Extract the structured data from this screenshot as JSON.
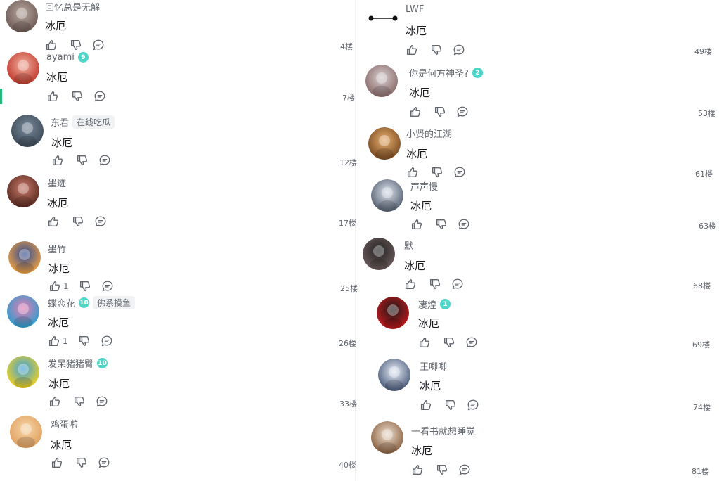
{
  "left": [
    {
      "user": "回忆总是无解",
      "level": "",
      "tag": "",
      "text": "冰厄",
      "likes": "",
      "floor": "4楼"
    },
    {
      "user": "ayami",
      "level": "9",
      "tag": "",
      "text": "冰厄",
      "likes": "",
      "floor": "7楼"
    },
    {
      "user": "东君",
      "level": "",
      "tag": "在线吃瓜",
      "text": "冰厄",
      "likes": "",
      "floor": "12楼"
    },
    {
      "user": "墨迹",
      "level": "",
      "tag": "",
      "text": "冰厄",
      "likes": "",
      "floor": "17楼"
    },
    {
      "user": "墨竹",
      "level": "",
      "tag": "",
      "text": "冰厄",
      "likes": "1",
      "floor": "25楼"
    },
    {
      "user": "蝶恋花",
      "level": "10",
      "tag": "佛系摸鱼",
      "text": "冰厄",
      "likes": "1",
      "floor": "26楼"
    },
    {
      "user": "发呆猪猪臀",
      "level": "10",
      "tag": "",
      "text": "冰厄",
      "likes": "",
      "floor": "33楼"
    },
    {
      "user": "鸡蛋啦",
      "level": "",
      "tag": "",
      "text": "冰厄",
      "likes": "",
      "floor": "40楼"
    }
  ],
  "right": [
    {
      "user": "LWF",
      "level": "",
      "tag": "",
      "text": "冰厄",
      "likes": "",
      "floor": "49楼"
    },
    {
      "user": "你是何方神圣?",
      "level": "2",
      "tag": "",
      "text": "冰厄",
      "likes": "",
      "floor": "53楼"
    },
    {
      "user": "小贤的江湖",
      "level": "",
      "tag": "",
      "text": "冰厄",
      "likes": "",
      "floor": "61楼"
    },
    {
      "user": "声声慢",
      "level": "",
      "tag": "",
      "text": "冰厄",
      "likes": "",
      "floor": "63楼"
    },
    {
      "user": "默",
      "level": "",
      "tag": "",
      "text": "冰厄",
      "likes": "",
      "floor": "68楼"
    },
    {
      "user": "凄煌",
      "level": "1",
      "tag": "",
      "text": "冰厄",
      "likes": "",
      "floor": "69楼"
    },
    {
      "user": "王唧唧",
      "level": "",
      "tag": "",
      "text": "冰厄",
      "likes": "",
      "floor": "74楼"
    },
    {
      "user": "一看书就想睡觉",
      "level": "",
      "tag": "",
      "text": "冰厄",
      "likes": "",
      "floor": "81楼"
    }
  ],
  "colors": {
    "accent": "#1eb879",
    "level_badge": "#4fd6c8",
    "muted_text": "#61666d",
    "text": "#18191c"
  },
  "icons": {
    "like": "thumbs-up-icon",
    "dislike": "thumbs-down-icon",
    "reply": "reply-bubble-icon"
  }
}
